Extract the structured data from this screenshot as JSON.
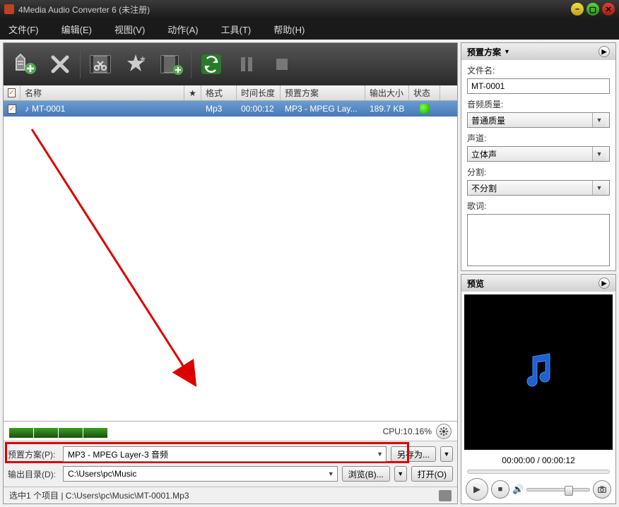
{
  "title": "4Media Audio Converter 6 (未注册)",
  "menu": [
    "文件(F)",
    "编辑(E)",
    "视图(V)",
    "动作(A)",
    "工具(T)",
    "帮助(H)"
  ],
  "columns": {
    "chk": "",
    "name": "名称",
    "star": "★",
    "fmt": "格式",
    "dur": "时间长度",
    "preset": "预置方案",
    "size": "输出大小",
    "stat": "状态"
  },
  "row": {
    "name": "MT-0001",
    "fmt": "Mp3",
    "dur": "00:00:12",
    "preset": "MP3 - MPEG Lay...",
    "size": "189.7 KB"
  },
  "cpu": "CPU:10.16%",
  "preset_row": {
    "label": "预置方案(P):",
    "value": "MP3 - MPEG Layer-3 音频",
    "saveas": "另存为..."
  },
  "outdir_row": {
    "label": "输出目录(D):",
    "value": "C:\\Users\\pc\\Music",
    "browse": "浏览(B)...",
    "open": "打开(O)"
  },
  "status": "选中1 个项目 | C:\\Users\\pc\\Music\\MT-0001.Mp3",
  "sidebar": {
    "preset_title": "预置方案",
    "filename_label": "文件名:",
    "filename_value": "MT-0001",
    "quality_label": "音频质量:",
    "quality_value": "普通质量",
    "channel_label": "声道:",
    "channel_value": "立体声",
    "split_label": "分割:",
    "split_value": "不分割",
    "lyrics_label": "歌词:"
  },
  "preview": {
    "title": "预览",
    "time": "00:00:00 / 00:00:12"
  }
}
